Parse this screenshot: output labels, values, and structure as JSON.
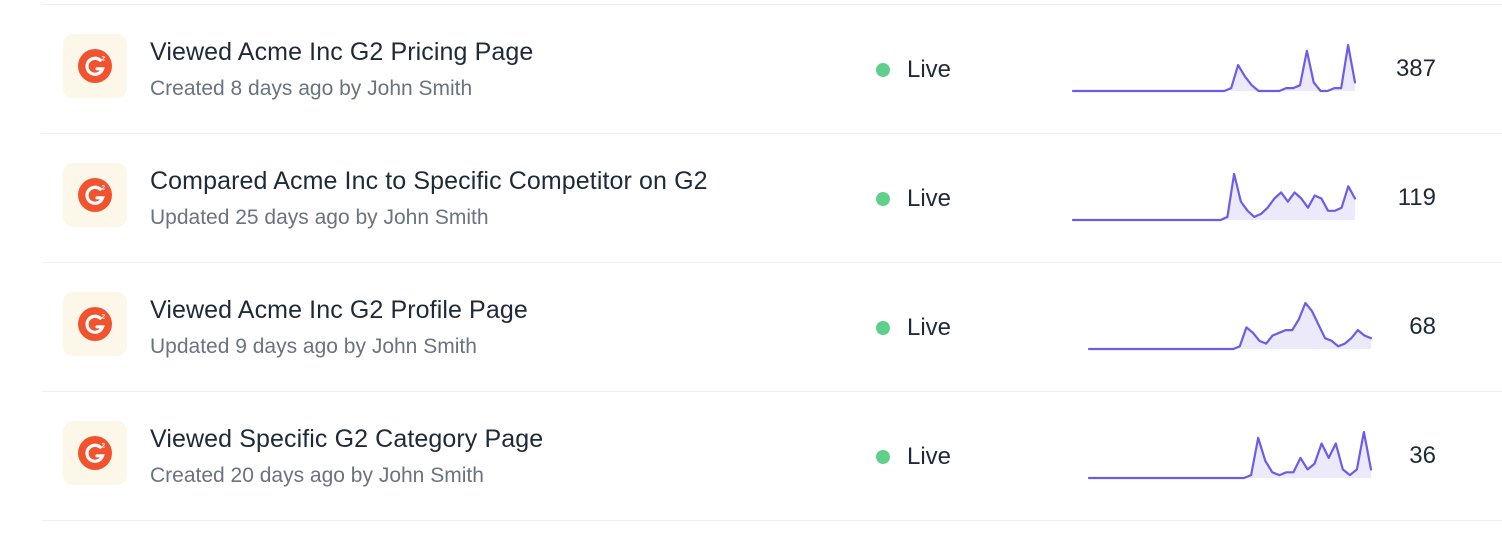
{
  "brand": {
    "logo_color": "#f2532f",
    "tile_color": "#fdf7ea"
  },
  "colors": {
    "live": "#5fd08b",
    "sparkline": "#6c5ce7",
    "sparkline_fill": "#ece9fb"
  },
  "rows": [
    {
      "icon": "g2-logo-icon",
      "title": "Viewed Acme Inc G2 Pricing Page",
      "meta": "Created 8 days ago by John Smith",
      "status": "Live",
      "count": "387",
      "trend": [
        0,
        0,
        0,
        0,
        0,
        0,
        0,
        0,
        0,
        0,
        0,
        0,
        0,
        0,
        0,
        0,
        0,
        0,
        0,
        0,
        0,
        0,
        0,
        1,
        9,
        5,
        2,
        0,
        0,
        0,
        0,
        1,
        1,
        2,
        14,
        3,
        0,
        0,
        1,
        1,
        16,
        3
      ]
    },
    {
      "icon": "g2-logo-icon",
      "title": "Compared Acme Inc to Specific Competitor on G2",
      "meta": "Updated 25 days ago by John Smith",
      "status": "Live",
      "count": "119",
      "trend": [
        0,
        0,
        0,
        0,
        0,
        0,
        0,
        0,
        0,
        0,
        0,
        0,
        0,
        0,
        0,
        0,
        0,
        0,
        0,
        0,
        0,
        0,
        0,
        1,
        15,
        6,
        3,
        1,
        2,
        4,
        7,
        9,
        6,
        9,
        7,
        4,
        8,
        7,
        3,
        3,
        4,
        11,
        7
      ]
    },
    {
      "icon": "g2-logo-icon",
      "title": "Viewed Acme Inc G2 Profile Page",
      "meta": "Updated 9 days ago by John Smith",
      "status": "Live",
      "count": "68",
      "trend": [
        0,
        0,
        0,
        0,
        0,
        0,
        0,
        0,
        0,
        0,
        0,
        0,
        0,
        0,
        0,
        0,
        0,
        0,
        0,
        0,
        0,
        0,
        0,
        1,
        8,
        6,
        3,
        2,
        5,
        6,
        7,
        7,
        11,
        17,
        14,
        9,
        4,
        3,
        1,
        2,
        4,
        7,
        5,
        4
      ]
    },
    {
      "icon": "g2-logo-icon",
      "title": "Viewed Specific G2 Category Page",
      "meta": "Created 20 days ago by John Smith",
      "status": "Live",
      "count": "36",
      "trend": [
        0,
        0,
        0,
        0,
        0,
        0,
        0,
        0,
        0,
        0,
        0,
        0,
        0,
        0,
        0,
        0,
        0,
        0,
        0,
        0,
        0,
        0,
        0,
        1,
        14,
        6,
        2,
        1,
        2,
        2,
        7,
        3,
        5,
        12,
        7,
        12,
        3,
        1,
        3,
        16,
        3
      ]
    }
  ]
}
